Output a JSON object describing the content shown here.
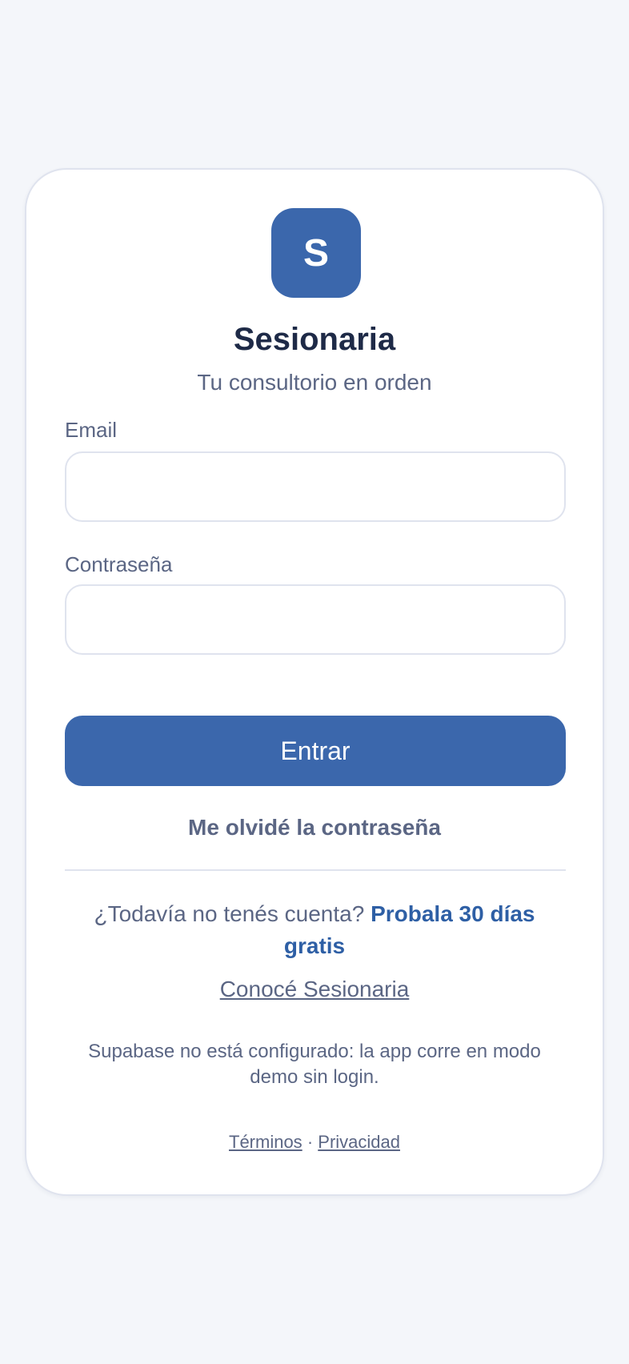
{
  "brand": {
    "logo_letter": "S",
    "name": "Sesionaria",
    "tagline": "Tu consultorio en orden"
  },
  "form": {
    "email_label": "Email",
    "email_value": "",
    "password_label": "Contraseña",
    "password_value": "",
    "submit_label": "Entrar",
    "forgot_label": "Me olvidé la contraseña"
  },
  "signup": {
    "prompt": "¿Todavía no tenés cuenta?",
    "link_label": "Probala 30 días gratis"
  },
  "learn_more_label": "Conocé Sesionaria",
  "notice": "Supabase no está configurado: la app corre en modo demo sin login.",
  "footer": {
    "terms_label": "Términos",
    "separator": "·",
    "privacy_label": "Privacidad"
  },
  "colors": {
    "accent": "#3b67ac",
    "link": "#2e5fa5",
    "background": "#f4f6fa",
    "text_primary": "#1e2a47",
    "text_secondary": "#5b6684",
    "border": "#dfe3ee"
  }
}
